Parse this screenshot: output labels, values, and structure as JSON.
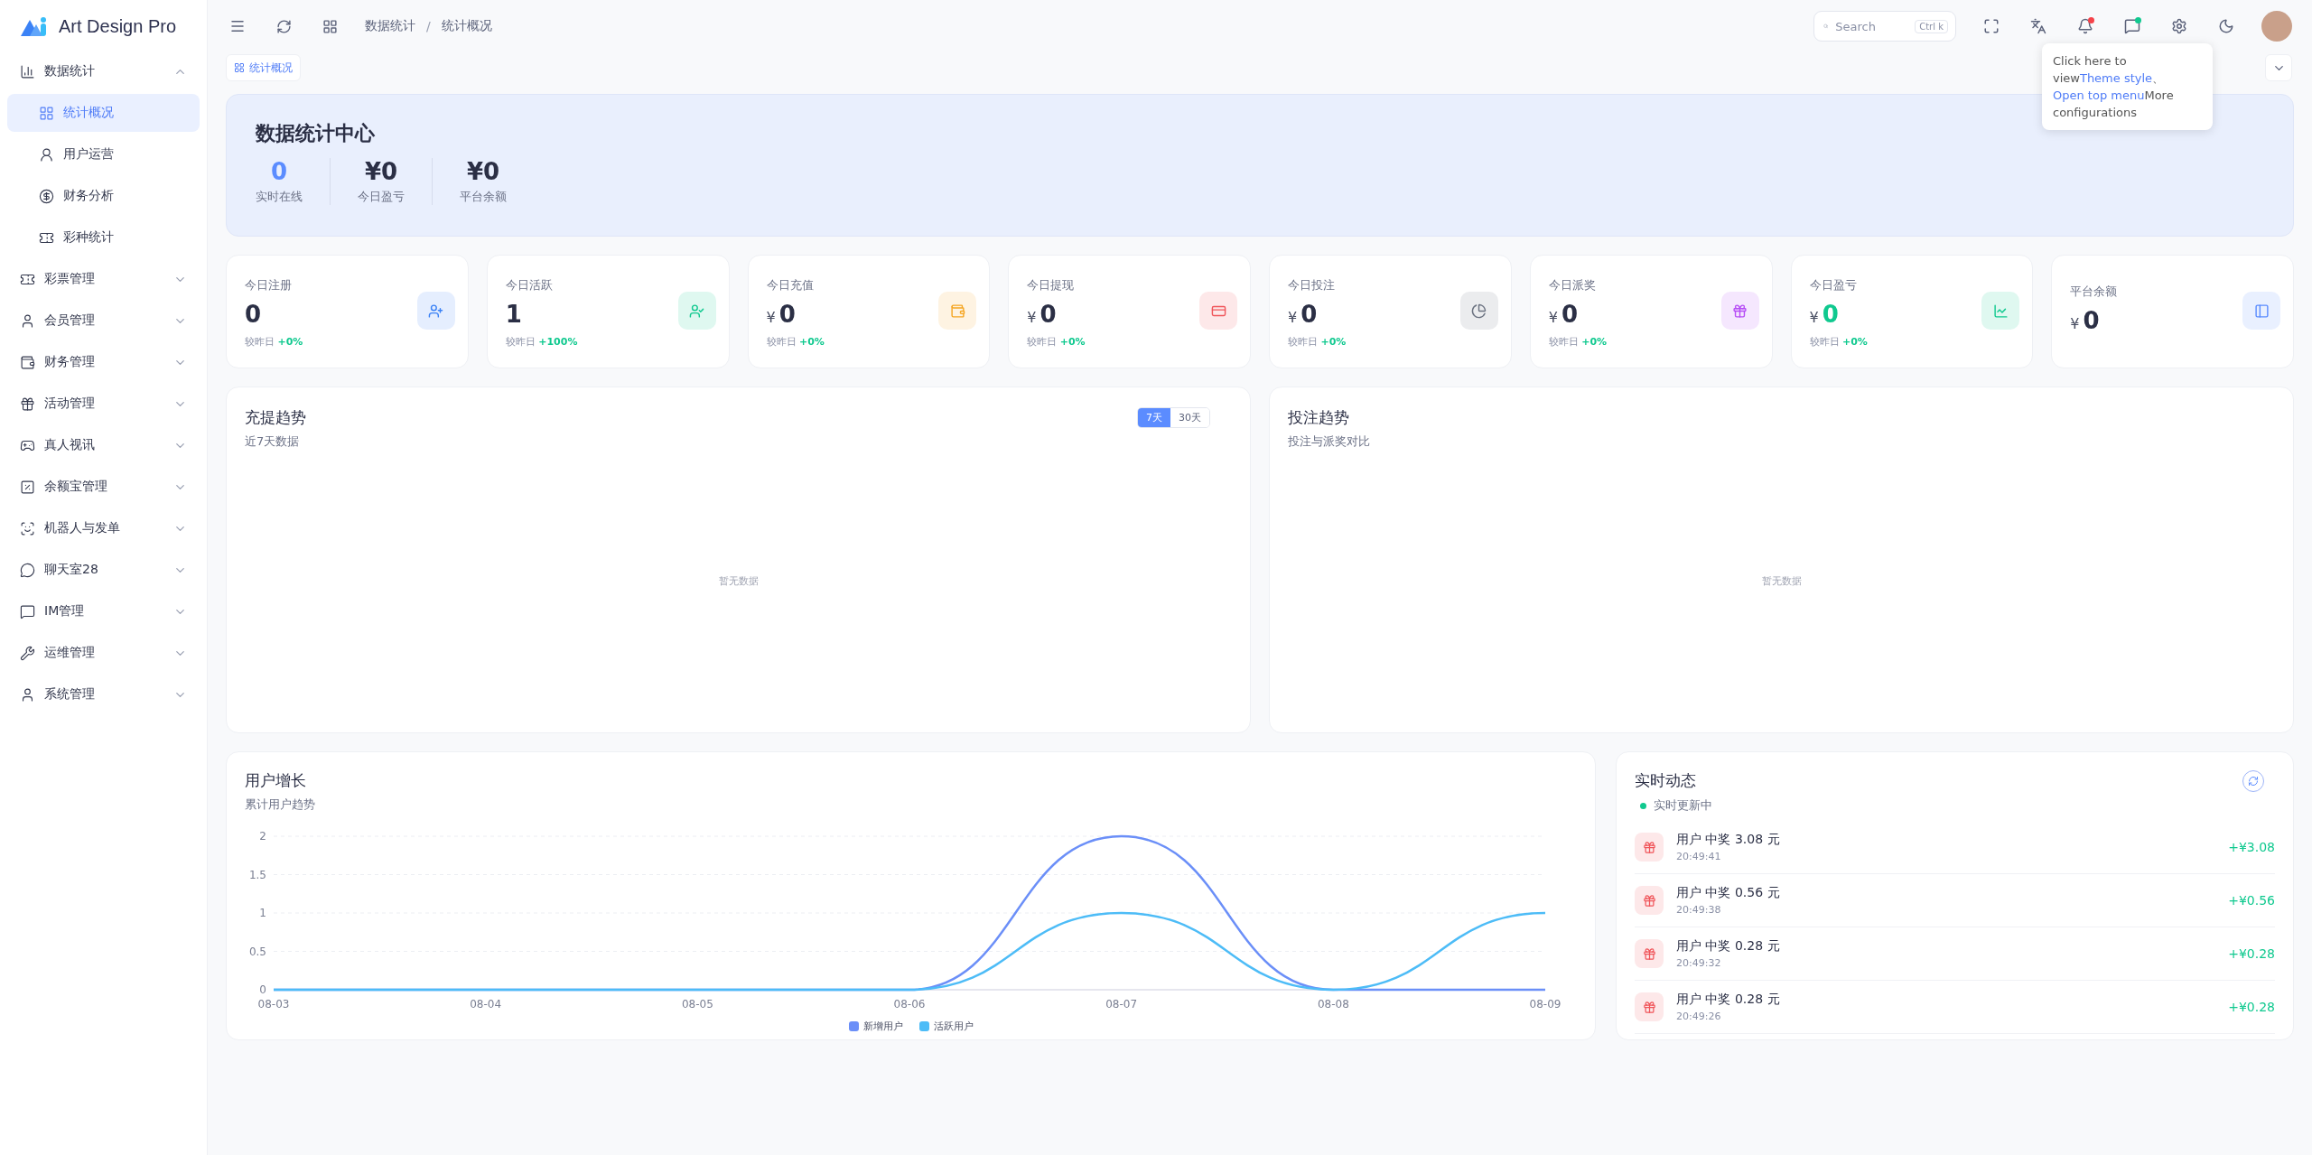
{
  "sidebar": {
    "logo": "Art Design Pro",
    "items": [
      {
        "label": "数据统计",
        "expanded": true,
        "children": [
          {
            "label": "统计概况",
            "selected": true
          },
          {
            "label": "用户运营",
            "selected": false
          },
          {
            "label": "财务分析",
            "selected": false
          },
          {
            "label": "彩种统计",
            "selected": false
          }
        ]
      },
      {
        "label": "彩票管理",
        "expanded": false
      },
      {
        "label": "会员管理",
        "expanded": false
      },
      {
        "label": "财务管理",
        "expanded": false
      },
      {
        "label": "活动管理",
        "expanded": false
      },
      {
        "label": "真人视讯",
        "expanded": false
      },
      {
        "label": "余额宝管理",
        "expanded": false
      },
      {
        "label": "机器人与发单",
        "expanded": false
      },
      {
        "label": "聊天室28",
        "expanded": false
      },
      {
        "label": "IM管理",
        "expanded": false
      },
      {
        "label": "运维管理",
        "expanded": false
      },
      {
        "label": "系统管理",
        "expanded": false
      }
    ]
  },
  "topbar": {
    "breadcrumb": [
      "数据统计",
      "统计概况"
    ],
    "breadcrumb_separator": "/",
    "search": {
      "placeholder": "Search",
      "shortcut_1": "Ctrl",
      "shortcut_2": "k"
    }
  },
  "tooltip": [
    {
      "text": "Click here to view",
      "link": false
    },
    {
      "text": "Theme style",
      "link": true
    },
    {
      "text": "、 ",
      "link": false
    },
    {
      "text": "Open top menu",
      "link": true
    },
    {
      "text": "More configurations",
      "link": false
    }
  ],
  "tabs": [
    {
      "label": "统计概况",
      "selected": true
    }
  ],
  "banner": {
    "title": "数据统计中心",
    "stats": [
      {
        "value": "0",
        "label": "实时在线",
        "highlight": true
      },
      {
        "value": "¥0",
        "label": "今日盈亏",
        "highlight": false
      },
      {
        "value": "¥0",
        "label": "平台余额",
        "highlight": false
      }
    ]
  },
  "stat_cards": [
    {
      "label": "今日注册",
      "value": "0",
      "change_label": "较昨日",
      "change": "+0%",
      "color": "#3b82f6",
      "highlight": false
    },
    {
      "label": "今日活跃",
      "value": "1",
      "change_label": "较昨日",
      "change": "+100%",
      "color": "#10c98f",
      "highlight": false
    },
    {
      "label": "今日充值",
      "currency": "¥",
      "value": "0",
      "change_label": "较昨日",
      "change": "+0%",
      "color": "#f5a623",
      "highlight": false
    },
    {
      "label": "今日提现",
      "currency": "¥",
      "value": "0",
      "change_label": "较昨日",
      "change": "+0%",
      "color": "#f0555a",
      "highlight": false
    },
    {
      "label": "今日投注",
      "currency": "¥",
      "value": "0",
      "change_label": "较昨日",
      "change": "+0%",
      "color": "#6b7280",
      "highlight": false
    },
    {
      "label": "今日派奖",
      "currency": "¥",
      "value": "0",
      "change_label": "较昨日",
      "change": "+0%",
      "color": "#b64df5",
      "highlight": false
    },
    {
      "label": "今日盈亏",
      "currency": "¥",
      "value": "0",
      "change_label": "较昨日",
      "change": "+0%",
      "color": "#10c98f",
      "highlight": true
    },
    {
      "label": "平台余额",
      "currency": "¥",
      "value": "0",
      "color": "#5b8cff",
      "highlight": false
    }
  ],
  "trend_cards": [
    {
      "title": "充提趋势",
      "subtitle": "近7天数据",
      "empty_text": "暂无数据",
      "ranges": [
        {
          "label": "7天",
          "selected": true
        },
        {
          "label": "30天",
          "selected": false
        }
      ]
    },
    {
      "title": "投注趋势",
      "subtitle": "投注与派奖对比",
      "empty_text": "暂无数据"
    }
  ],
  "user_growth": {
    "title": "用户增长",
    "subtitle": "累计用户趋势",
    "chart_data": {
      "type": "line",
      "grid": true,
      "legend": true,
      "categories": [
        "08-03",
        "08-04",
        "08-05",
        "08-06",
        "08-07",
        "08-08",
        "08-09"
      ],
      "yticks": [
        0,
        0.5,
        1,
        1.5,
        2
      ],
      "ylim": [
        0,
        2
      ],
      "series": [
        {
          "name": "新增用户",
          "color": "#6b8ff8",
          "values": [
            0,
            0,
            0,
            0,
            2,
            0,
            0
          ]
        },
        {
          "name": "活跃用户",
          "color": "#4dbcf7",
          "values": [
            0,
            0,
            0,
            0,
            1,
            0,
            1
          ]
        }
      ]
    }
  },
  "activity": {
    "title": "实时动态",
    "status": "实时更新中",
    "items": [
      {
        "text": "用户 中奖 3.08 元",
        "time": "20:49:41",
        "amount": "+¥3.08"
      },
      {
        "text": "用户 中奖 0.56 元",
        "time": "20:49:38",
        "amount": "+¥0.56"
      },
      {
        "text": "用户 中奖 0.28 元",
        "time": "20:49:32",
        "amount": "+¥0.28"
      },
      {
        "text": "用户 中奖 0.28 元",
        "time": "20:49:26",
        "amount": "+¥0.28"
      }
    ]
  }
}
